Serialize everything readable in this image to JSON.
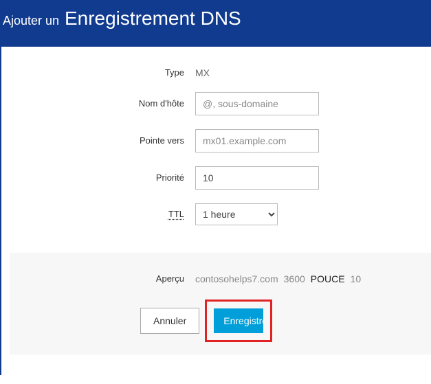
{
  "header": {
    "prefix": "Ajouter un",
    "title": "Enregistrement DNS"
  },
  "form": {
    "type_label": "Type",
    "type_value": "MX",
    "host_label": "Nom d'hôte",
    "host_placeholder": "@, sous-domaine",
    "points_label": "Pointe vers",
    "points_placeholder": "mx01.example.com",
    "priority_label": "Priorité",
    "priority_value": "10",
    "ttl_label": "TTL",
    "ttl_value": "1 heure"
  },
  "preview": {
    "label": "Aperçu",
    "domain": "contosohelps7.com",
    "ttl_seconds": "3600",
    "class": "POUCE",
    "priority": "10"
  },
  "actions": {
    "cancel": "Annuler",
    "save": "Enregistrer"
  }
}
